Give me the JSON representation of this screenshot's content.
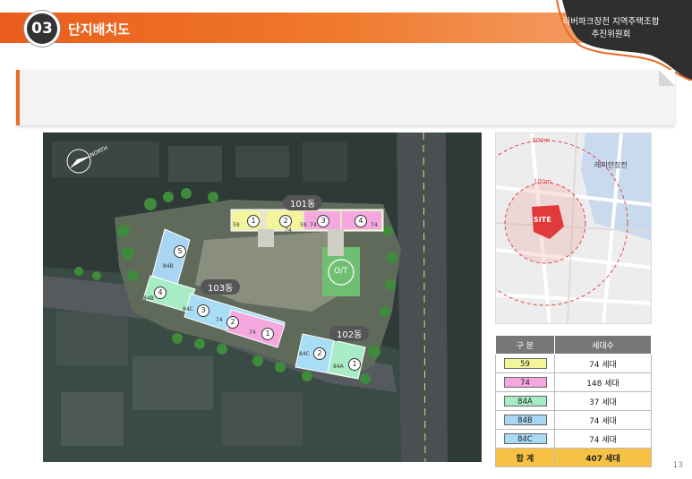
{
  "header": {
    "section_number": "03",
    "section_title": "단지배치도",
    "org_line1": "리버파크장전 지역주택조합",
    "org_line2": "추진위원회"
  },
  "site_plan": {
    "north_label": "NORTH",
    "buildings": [
      {
        "label": "101동"
      },
      {
        "label": "103동"
      },
      {
        "label": "102동"
      }
    ],
    "ot_label": "O/T",
    "unit_numbers_101": [
      "1",
      "2",
      "3",
      "4"
    ],
    "unit_types_101": [
      "59",
      "74",
      "59",
      "74",
      "74"
    ],
    "unit_numbers_103": [
      "5",
      "4",
      "3",
      "2",
      "1"
    ],
    "unit_types_103": [
      "84B",
      "84B",
      "84C",
      "74",
      "74"
    ],
    "unit_numbers_102": [
      "2",
      "1"
    ],
    "unit_types_102": [
      "84C",
      "84A"
    ]
  },
  "location_map": {
    "site_label": "SITE",
    "radius_outer": "300m",
    "radius_inner": "100m",
    "river_label": "레미안장전"
  },
  "table": {
    "headers": [
      "구 분",
      "세대수"
    ],
    "rows": [
      {
        "type": "59",
        "count": "74 세대",
        "color": "#f4f59a"
      },
      {
        "type": "74",
        "count": "148 세대",
        "color": "#f5a8e0"
      },
      {
        "type": "84A",
        "count": "37 세대",
        "color": "#a8ecc5"
      },
      {
        "type": "84B",
        "count": "74 세대",
        "color": "#a8d6f2"
      },
      {
        "type": "84C",
        "count": "74 세대",
        "color": "#a9dcf5"
      }
    ],
    "total_label": "합 계",
    "total_count": "407 세대"
  },
  "page_number": "13",
  "colors": {
    "accent": "#e95d1c",
    "dark": "#333333"
  }
}
